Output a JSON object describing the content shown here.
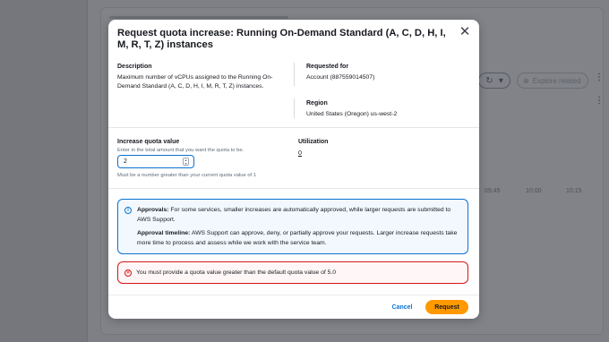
{
  "background": {
    "refresh_icon": "refresh-icon",
    "dropdown_icon": "caret-down-icon",
    "explore_label": "Explore related",
    "explore_icon": "compass-icon",
    "axis_ticks": [
      "09:45",
      "10:00",
      "10:15"
    ]
  },
  "modal": {
    "title": "Request quota increase: Running On-Demand Standard (A, C, D, H, I, M, R, T, Z) instances",
    "close_icon": "close-icon",
    "description_label": "Description",
    "description_text": "Maximum number of vCPUs assigned to the Running On-Demand Standard (A, C, D, H, I, M, R, T, Z) instances.",
    "requested_for_label": "Requested for",
    "requested_for_value": "Account (887559014507)",
    "region_label": "Region",
    "region_value": "United States (Oregon) us-west-2",
    "increase_label": "Increase quota value",
    "increase_description": "Enter in the total amount that you want the quota to be.",
    "increase_value": "2",
    "increase_hint": "Must be a number greater than your current quota value of 1",
    "utilization_label": "Utilization",
    "utilization_value": "0",
    "info": {
      "icon": "info-icon",
      "approvals_label": "Approvals:",
      "approvals_text": "For some services, smaller increases are automatically approved, while larger requests are submitted to AWS Support.",
      "timeline_label": "Approval timeline:",
      "timeline_text": "AWS Support can approve, deny, or partially approve your requests. Larger increase requests take more time to process and assess while we work with the service team."
    },
    "error": {
      "icon": "error-icon",
      "text": "You must provide a quota value greater than the default quota value of 5.0"
    },
    "cancel_label": "Cancel",
    "request_label": "Request"
  },
  "colors": {
    "primary": "#0972d3",
    "request_button": "#ff9900",
    "error": "#d91515"
  }
}
